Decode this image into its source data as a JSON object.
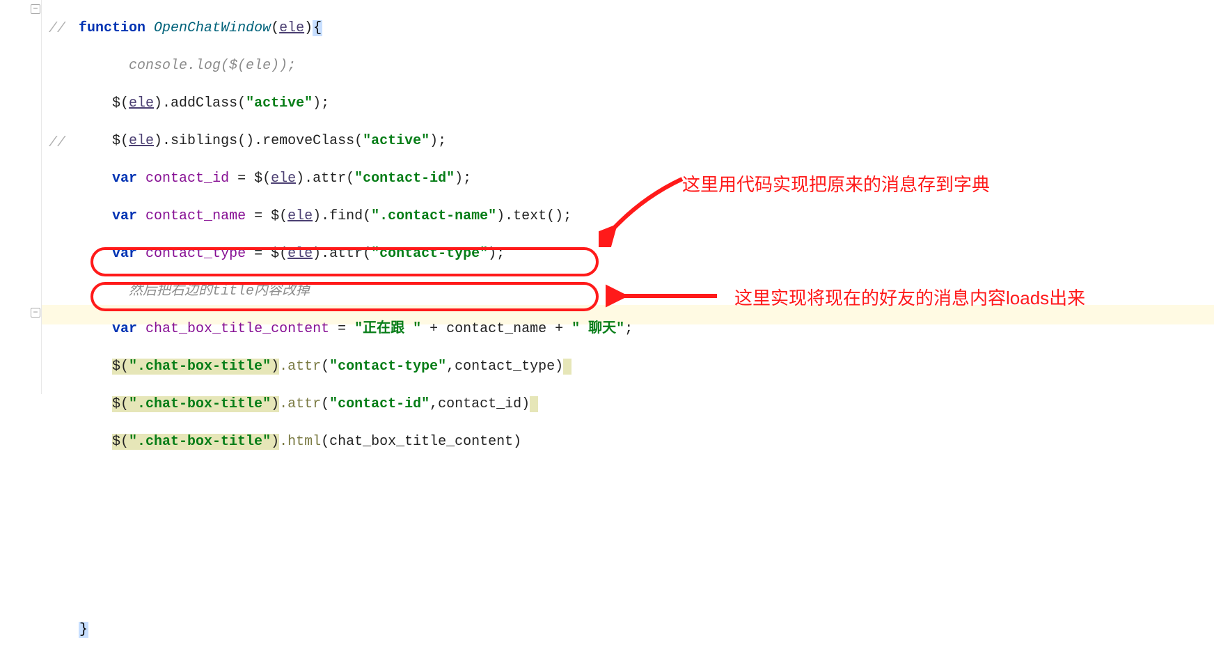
{
  "code": {
    "fn_keyword": "function",
    "fn_name": "OpenChatWindow",
    "param": "ele",
    "brace_open": "{",
    "brace_close": "}",
    "line2_comment": "console.log($(ele));",
    "line3_a": "$(",
    "line3_b": ").addClass(",
    "line3_str": "\"active\"",
    "line3_c": ");",
    "line4_a": "$(",
    "line4_b": ").siblings().removeClass(",
    "line4_str": "\"active\"",
    "line4_c": ");",
    "var_kw": "var",
    "line5_var": "contact_id",
    "line5_b": " = $(",
    "line5_c": ").attr(",
    "line5_str": "\"contact-id\"",
    "line5_d": ");",
    "line6_var": "contact_name",
    "line6_b": " = $(",
    "line6_c": ").find(",
    "line6_str": "\".contact-name\"",
    "line6_d": ").text();",
    "line7_var": "contact_type",
    "line7_b": " = $(",
    "line7_c": ").attr(",
    "line7_str": "\"contact-type\"",
    "line7_d": ");",
    "line8_comment": "然后把右边的title内容改掉",
    "line9_var": "chat_box_title_content",
    "line9_b": " = ",
    "line9_s1": "\"正在跟 \"",
    "line9_c": " + contact_name + ",
    "line9_s2": "\" 聊天\"",
    "line9_d": ";",
    "line10_a": "$(",
    "line10_s": "\".chat-box-title\"",
    "line10_b": ").attr(",
    "line10_s2": "\"contact-type\"",
    "line10_c": ",contact_type)",
    "line11_a": "$(",
    "line11_s": "\".chat-box-title\"",
    "line11_b": ").attr(",
    "line11_s2": "\"contact-id\"",
    "line11_c": ",contact_id)",
    "line12_a": "$(",
    "line12_s": "\".chat-box-title\"",
    "line12_b": ").html(chat_box_title_content)"
  },
  "annotations": {
    "label1": "这里用代码实现把原来的消息存到字典",
    "label2": "这里实现将现在的好友的消息内容loads出来"
  },
  "gutter": {
    "comment_marker": "//"
  }
}
